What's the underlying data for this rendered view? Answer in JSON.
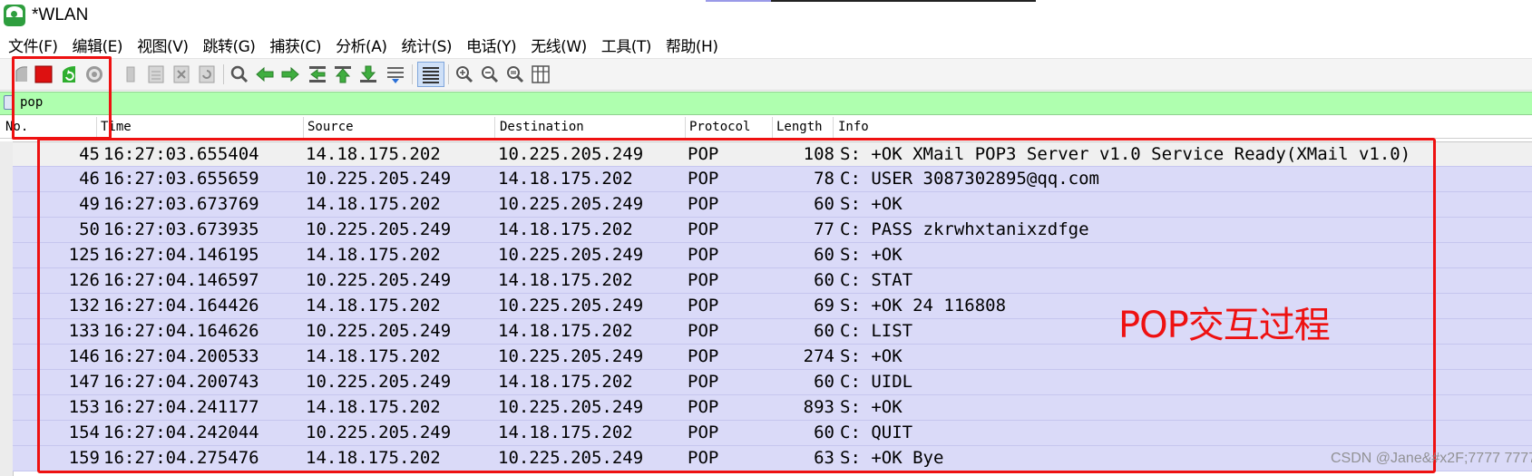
{
  "window": {
    "title": "*WLAN"
  },
  "menu": [
    "文件(F)",
    "编辑(E)",
    "视图(V)",
    "跳转(G)",
    "捕获(C)",
    "分析(A)",
    "统计(S)",
    "电话(Y)",
    "无线(W)",
    "工具(T)",
    "帮助(H)"
  ],
  "toolbar": {
    "icons": [
      "start-capture-icon",
      "stop-capture-icon",
      "restart-capture-icon",
      "capture-options-icon",
      "open-file-icon",
      "save-file-icon",
      "close-file-icon",
      "reload-file-icon",
      "find-packet-icon",
      "go-back-icon",
      "go-forward-icon",
      "go-to-packet-icon",
      "first-packet-icon",
      "last-packet-icon",
      "auto-scroll-icon",
      "colorize-icon",
      "zoom-in-icon",
      "zoom-out-icon",
      "normal-size-icon",
      "resize-columns-icon"
    ],
    "colors": {
      "stop": "#dd1111",
      "restart": "#2fae2f",
      "toolbar_bg": "#f4f4f4"
    }
  },
  "filter": {
    "value": "pop",
    "bg_color": "#afffaf"
  },
  "columns": {
    "no": "No.",
    "time": "Time",
    "source": "Source",
    "destination": "Destination",
    "protocol": "Protocol",
    "length": "Length",
    "info": "Info"
  },
  "packets": [
    {
      "no": "45",
      "time": "16:27:03.655404",
      "src": "14.18.175.202",
      "dst": "10.225.205.249",
      "proto": "POP",
      "len": "108",
      "info": "S: +OK XMail POP3 Server v1.0 Service Ready(XMail v1.0)"
    },
    {
      "no": "46",
      "time": "16:27:03.655659",
      "src": "10.225.205.249",
      "dst": "14.18.175.202",
      "proto": "POP",
      "len": "78",
      "info": "C: USER 3087302895@qq.com"
    },
    {
      "no": "49",
      "time": "16:27:03.673769",
      "src": "14.18.175.202",
      "dst": "10.225.205.249",
      "proto": "POP",
      "len": "60",
      "info": "S: +OK"
    },
    {
      "no": "50",
      "time": "16:27:03.673935",
      "src": "10.225.205.249",
      "dst": "14.18.175.202",
      "proto": "POP",
      "len": "77",
      "info": "C: PASS zkrwhxtanixzdfge"
    },
    {
      "no": "125",
      "time": "16:27:04.146195",
      "src": "14.18.175.202",
      "dst": "10.225.205.249",
      "proto": "POP",
      "len": "60",
      "info": "S: +OK"
    },
    {
      "no": "126",
      "time": "16:27:04.146597",
      "src": "10.225.205.249",
      "dst": "14.18.175.202",
      "proto": "POP",
      "len": "60",
      "info": "C: STAT"
    },
    {
      "no": "132",
      "time": "16:27:04.164426",
      "src": "14.18.175.202",
      "dst": "10.225.205.249",
      "proto": "POP",
      "len": "69",
      "info": "S: +OK 24 116808"
    },
    {
      "no": "133",
      "time": "16:27:04.164626",
      "src": "10.225.205.249",
      "dst": "14.18.175.202",
      "proto": "POP",
      "len": "60",
      "info": "C: LIST"
    },
    {
      "no": "146",
      "time": "16:27:04.200533",
      "src": "14.18.175.202",
      "dst": "10.225.205.249",
      "proto": "POP",
      "len": "274",
      "info": "S: +OK"
    },
    {
      "no": "147",
      "time": "16:27:04.200743",
      "src": "10.225.205.249",
      "dst": "14.18.175.202",
      "proto": "POP",
      "len": "60",
      "info": "C: UIDL"
    },
    {
      "no": "153",
      "time": "16:27:04.241177",
      "src": "14.18.175.202",
      "dst": "10.225.205.249",
      "proto": "POP",
      "len": "893",
      "info": "S: +OK"
    },
    {
      "no": "154",
      "time": "16:27:04.242044",
      "src": "10.225.205.249",
      "dst": "14.18.175.202",
      "proto": "POP",
      "len": "60",
      "info": "C: QUIT"
    },
    {
      "no": "159",
      "time": "16:27:04.275476",
      "src": "14.18.175.202",
      "dst": "10.225.205.249",
      "proto": "POP",
      "len": "63",
      "info": "S: +OK Bye"
    }
  ],
  "row_colors": {
    "default": "#dadaf8",
    "first": "#f0f0f0"
  },
  "annotation": {
    "text": "POP交互过程",
    "color": "#ee1111"
  },
  "watermark": "CSDN @Jane&#x2F;7777 7777"
}
